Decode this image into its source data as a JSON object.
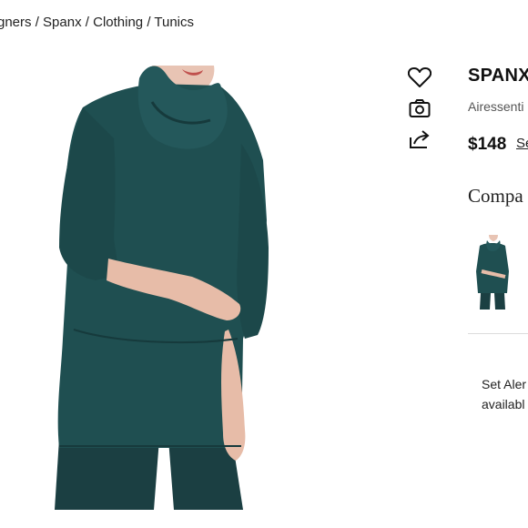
{
  "breadcrumb": {
    "items": [
      "gners",
      "Spanx",
      "Clothing",
      "Tunics"
    ],
    "separator": " / "
  },
  "product": {
    "brand": "SPANX",
    "name": "Airessenti",
    "price": "$148",
    "price_link": "Se",
    "image_color": "#1f4f51"
  },
  "actions": {
    "icons": [
      "heart-icon",
      "camera-icon",
      "share-icon"
    ]
  },
  "compare": {
    "title": "Compa"
  },
  "alert": {
    "line1": "Set Aler",
    "line2": "availabl"
  }
}
